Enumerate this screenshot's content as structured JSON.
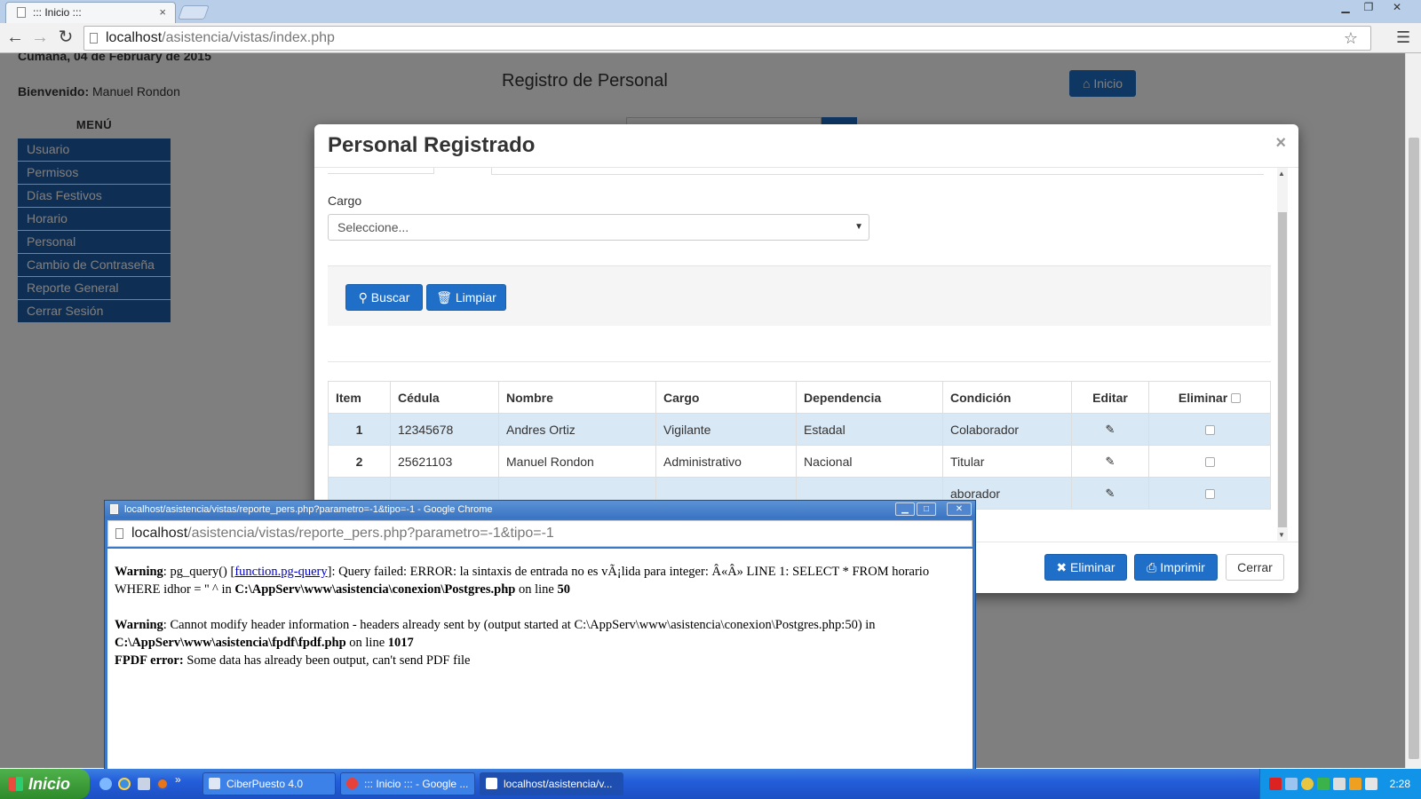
{
  "browser": {
    "tab_title": "::: Inicio :::",
    "tab_close": "×",
    "url_host": "localhost",
    "url_path": "/asistencia/vistas/index.php",
    "win_min": "▁",
    "win_max": "❐",
    "win_close": "✕",
    "back": "←",
    "forward": "→",
    "reload": "↻",
    "star": "☆",
    "menu": "☰"
  },
  "page": {
    "date_line": "Cumaná, 04 de February de 2015",
    "welcome_label": "Bienvenido:",
    "welcome_name": " Manuel Rondon",
    "menu_title": "MENÚ",
    "menu_items": [
      "Usuario",
      "Permisos",
      "Días Festivos",
      "Horario",
      "Personal",
      "Cambio de Contraseña",
      "Reporte General",
      "Cerrar Sesión"
    ],
    "heading": "Registro de Personal",
    "inicio_button": "Inicio",
    "accent_color": "#1f6fc8"
  },
  "modal": {
    "title": "Personal Registrado",
    "close": "×",
    "cargo_label": "Cargo",
    "cargo_selected": "Seleccione...",
    "buscar_button": "Buscar",
    "limpiar_button": "Limpiar",
    "table": {
      "headers": [
        "Item",
        "Cédula",
        "Nombre",
        "Cargo",
        "Dependencia",
        "Condición",
        "Editar",
        "Eliminar"
      ],
      "rows": [
        {
          "item": "1",
          "cedula": "12345678",
          "nombre": "Andres Ortiz",
          "cargo": "Vigilante",
          "dependencia": "Estadal",
          "condicion": "Colaborador"
        },
        {
          "item": "2",
          "cedula": "25621103",
          "nombre": "Manuel Rondon",
          "cargo": "Administrativo",
          "dependencia": "Nacional",
          "condicion": "Titular"
        },
        {
          "item": "",
          "cedula": "",
          "nombre": "",
          "cargo": "",
          "dependencia": "",
          "condicion": "aborador"
        }
      ]
    },
    "eliminar_button": "Eliminar",
    "imprimir_button": "Imprimir",
    "cerrar_button": "Cerrar"
  },
  "popup": {
    "title": "localhost/asistencia/vistas/reporte_pers.php?parametro=-1&tipo=-1 - Google Chrome",
    "url_host": "localhost",
    "url_path": "/asistencia/vistas/reporte_pers.php?parametro=-1&tipo=-1",
    "warning1_label": "Warning",
    "warning1_pre": ": pg_query() [",
    "warning1_link": "function.pg-query",
    "warning1_post": "]: Query failed: ERROR: la sintaxis de entrada no es vÃ¡lida para integer: Â«Â» LINE 1: SELECT * FROM horario WHERE idhor = '' ^ in ",
    "warning1_file": "C:\\AppServ\\www\\asistencia\\conexion\\Postgres.php",
    "warning1_online": " on line ",
    "warning1_line": "50",
    "warning2_label": "Warning",
    "warning2_text": ": Cannot modify header information - headers already sent by (output started at C:\\AppServ\\www\\asistencia\\conexion\\Postgres.php:50) in ",
    "warning2_file": "C:\\AppServ\\www\\asistencia\\fpdf\\fpdf.php",
    "warning2_online": " on line ",
    "warning2_line": "1017",
    "fpdf_label": "FPDF error:",
    "fpdf_text": " Some data has already been output, can't send PDF file"
  },
  "taskbar": {
    "start": "Inicio",
    "tasks": [
      "CiberPuesto 4.0",
      "::: Inicio ::: - Google ...",
      "localhost/asistencia/v..."
    ],
    "clock": "2:28"
  }
}
